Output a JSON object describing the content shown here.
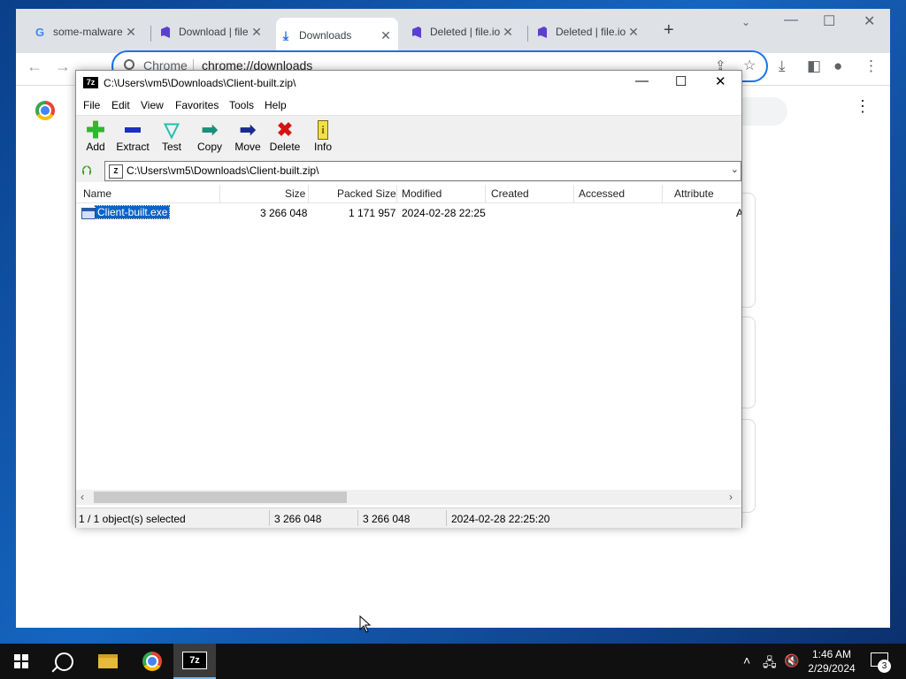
{
  "chrome": {
    "tabs": [
      {
        "title": "some-malware",
        "icon": "google-g-icon"
      },
      {
        "title": "Download | file",
        "icon": "file-io-icon"
      },
      {
        "title": "Downloads",
        "icon": "download-icon"
      },
      {
        "title": "Deleted | file.io",
        "icon": "file-io-icon"
      },
      {
        "title": "Deleted | file.io",
        "icon": "file-io-icon"
      }
    ],
    "new_tab": "+",
    "omnibox": {
      "chip": "Chrome",
      "url": "chrome://downloads"
    }
  },
  "sevenzip": {
    "app_tag": "7z",
    "title": "C:\\Users\\vm5\\Downloads\\Client-built.zip\\",
    "menu": [
      "File",
      "Edit",
      "View",
      "Favorites",
      "Tools",
      "Help"
    ],
    "toolbar": [
      {
        "label": "Add",
        "icon": "add-icon",
        "color": "#2db82d"
      },
      {
        "label": "Extract",
        "icon": "extract-icon",
        "color": "#1a2fc6"
      },
      {
        "label": "Test",
        "icon": "test-icon",
        "color": "#1fbfb0"
      },
      {
        "label": "Copy",
        "icon": "copy-icon",
        "color": "#1a8f7a"
      },
      {
        "label": "Move",
        "icon": "move-icon",
        "color": "#1a2a8f"
      },
      {
        "label": "Delete",
        "icon": "delete-icon",
        "color": "#d41414"
      },
      {
        "label": "Info",
        "icon": "info-icon",
        "color": "#c8b400"
      }
    ],
    "address": "C:\\Users\\vm5\\Downloads\\Client-built.zip\\",
    "columns": [
      "Name",
      "Size",
      "Packed Size",
      "Modified",
      "Created",
      "Accessed",
      "Attribute"
    ],
    "rows": [
      {
        "name": "Client-built.exe",
        "size": "3 266 048",
        "packed": "1 171 957",
        "modified": "2024-02-28 22:25",
        "created": "",
        "accessed": "",
        "attr": "A"
      }
    ],
    "status": {
      "selection": "1 / 1 object(s) selected",
      "size": "3 266 048",
      "packed": "3 266 048",
      "modified": "2024-02-28 22:25:20"
    }
  },
  "taskbar": {
    "app_7z_label": "7z",
    "clock_time": "1:46 AM",
    "clock_date": "2/29/2024",
    "notifications": "3"
  }
}
